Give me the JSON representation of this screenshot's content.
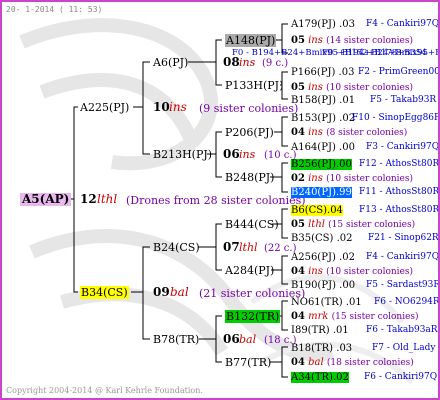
{
  "header": {
    "date": "20- 1-2014 ( 11: 53)"
  },
  "footer": {
    "copyright": "Copyright 2004-2014 @ Karl Kehrle Foundation."
  },
  "colors": {
    "frame": "#cc44cc",
    "pink": "#e8b8ee",
    "yellow": "#ffff00",
    "green": "#00cc00",
    "blue": "#0066ff",
    "gray": "#aaaaaa",
    "line": "#000000",
    "red": "#cc0000",
    "purple": "#7a00aa",
    "link": "#0000cc"
  },
  "root": {
    "label": "A5(AP)",
    "year": "12",
    "race": "lthl",
    "note": "(Drones from 28 sister colonies)"
  },
  "father": {
    "label": "A225(PJ)",
    "year": "10",
    "race": "ins",
    "note": "(9 sister colonies)"
  },
  "mother": {
    "label": "B34(CS)",
    "year": "09",
    "race": "bal",
    "note": "(21 sister colonies)"
  },
  "gen3": {
    "a6": {
      "label": "A6(PJ)",
      "year": "08",
      "race": "ins",
      "note": "(9 c.)"
    },
    "b213h": {
      "label": "B213H(PJ)",
      "year": "06",
      "race": "ins",
      "note": "(10 c.)"
    },
    "b24": {
      "label": "B24(CS)",
      "year": "07",
      "race": "lthl",
      "note": "(22 c.)"
    },
    "b78": {
      "label": "B78(TR)",
      "year": "06",
      "race": "bal",
      "note": "(18 c.)"
    }
  },
  "gen4": {
    "a148": {
      "label": "A148(PJ)",
      "overlay": "F0 - B194+B24+Bmix95+B152+B178+B354"
    },
    "p133h": {
      "label": "P133H(PJ)"
    },
    "p206": {
      "label": "P206(PJ)"
    },
    "b248": {
      "label": "B248(PJ)"
    },
    "b444": {
      "label": "B444(CS)"
    },
    "a284": {
      "label": "A284(PJ)"
    },
    "b132": {
      "label": "B132(TR)"
    },
    "b77": {
      "label": "B77(TR)"
    }
  },
  "gen5": [
    {
      "label": "A179(PJ)",
      "val": ".03",
      "right": "F4 - Cankiri97Q"
    },
    {
      "year": "05",
      "race": "ins",
      "note": "(14 sister colonies)"
    },
    {
      "overlay": "F0 - B194+B24+Bmix95+B152+B178+B354"
    },
    {
      "label": "P166(PJ)",
      "val": ".03",
      "right": "F2 - PrimGreen00"
    },
    {
      "year": "05",
      "race": "ins",
      "note": "(10 sister colonies)"
    },
    {
      "label": "B158(PJ)",
      "val": ".01",
      "right": "F5 - Takab93R"
    },
    {
      "label": "B153(PJ)",
      "val": ".02",
      "right": "F10 - SinopEgg86R"
    },
    {
      "year": "04",
      "race": "ins",
      "note": "(8 sister colonies)"
    },
    {
      "label": "A164(PJ)",
      "val": ".00",
      "right": "F3 - Cankiri97Q"
    },
    {
      "label": "B256(PJ)",
      "val": ".00",
      "right": "F12 - AthosSt80R"
    },
    {
      "year": "02",
      "race": "ins",
      "note": "(10 sister colonies)"
    },
    {
      "label": "B240(PJ)",
      "val": ".99",
      "right": "F11 - AthosSt80R"
    },
    {
      "label": "B6(CS)",
      "val": ".04",
      "right": "F13 - AthosSt80R"
    },
    {
      "year": "05",
      "race": "lthl",
      "note": "(15 sister colonies)"
    },
    {
      "label": "B35(CS)",
      "val": ".02",
      "right": "F21 - Sinop62R"
    },
    {
      "label": "A256(PJ)",
      "val": ".02",
      "right": "F4 - Cankiri97Q"
    },
    {
      "year": "04",
      "race": "ins",
      "note": "(10 sister colonies)"
    },
    {
      "label": "B190(PJ)",
      "val": ".00",
      "right": "F5 - Sardast93R"
    },
    {
      "label": "NO61(TR)",
      "val": ".01",
      "right": "F6 - NO6294R"
    },
    {
      "year": "04",
      "race": "mrk",
      "note": "(15 sister colonies)"
    },
    {
      "label": "I89(TR)",
      "val": ".01",
      "right": "F6 - Takab93aR"
    },
    {
      "label": "B18(TR)",
      "val": ".03",
      "right": "F7 - Old_Lady"
    },
    {
      "year": "04",
      "race": "bal",
      "note": "(18 sister colonies)"
    },
    {
      "label": "A34(TR)",
      "val": ".02",
      "right": "F6 - Cankiri97Q"
    }
  ]
}
